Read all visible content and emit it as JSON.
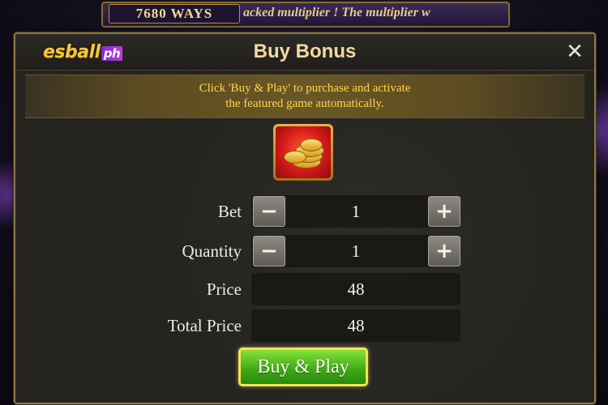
{
  "background": {
    "ways_label": "7680 WAYS",
    "ticker_text": "acked multiplier ! The multiplier w"
  },
  "dialog": {
    "logo": {
      "main": "esball",
      "sub": "ph"
    },
    "title": "Buy Bonus",
    "close_icon": "close-icon",
    "info_line1": "Click 'Buy & Play' to purchase and activate",
    "info_line2": "the featured game automatically.",
    "bonus_icon": "gold-coins-icon"
  },
  "form": {
    "bet": {
      "label": "Bet",
      "value": "1",
      "minus": "−",
      "plus": "+"
    },
    "quantity": {
      "label": "Quantity",
      "value": "1",
      "minus": "−",
      "plus": "+"
    },
    "price": {
      "label": "Price",
      "value": "48"
    },
    "total_price": {
      "label": "Total Price",
      "value": "48"
    }
  },
  "buy_button_label": "Buy & Play",
  "colors": {
    "accent_gold": "#ffd54a",
    "button_green": "#3aa814",
    "title": "#f3d9a0"
  }
}
